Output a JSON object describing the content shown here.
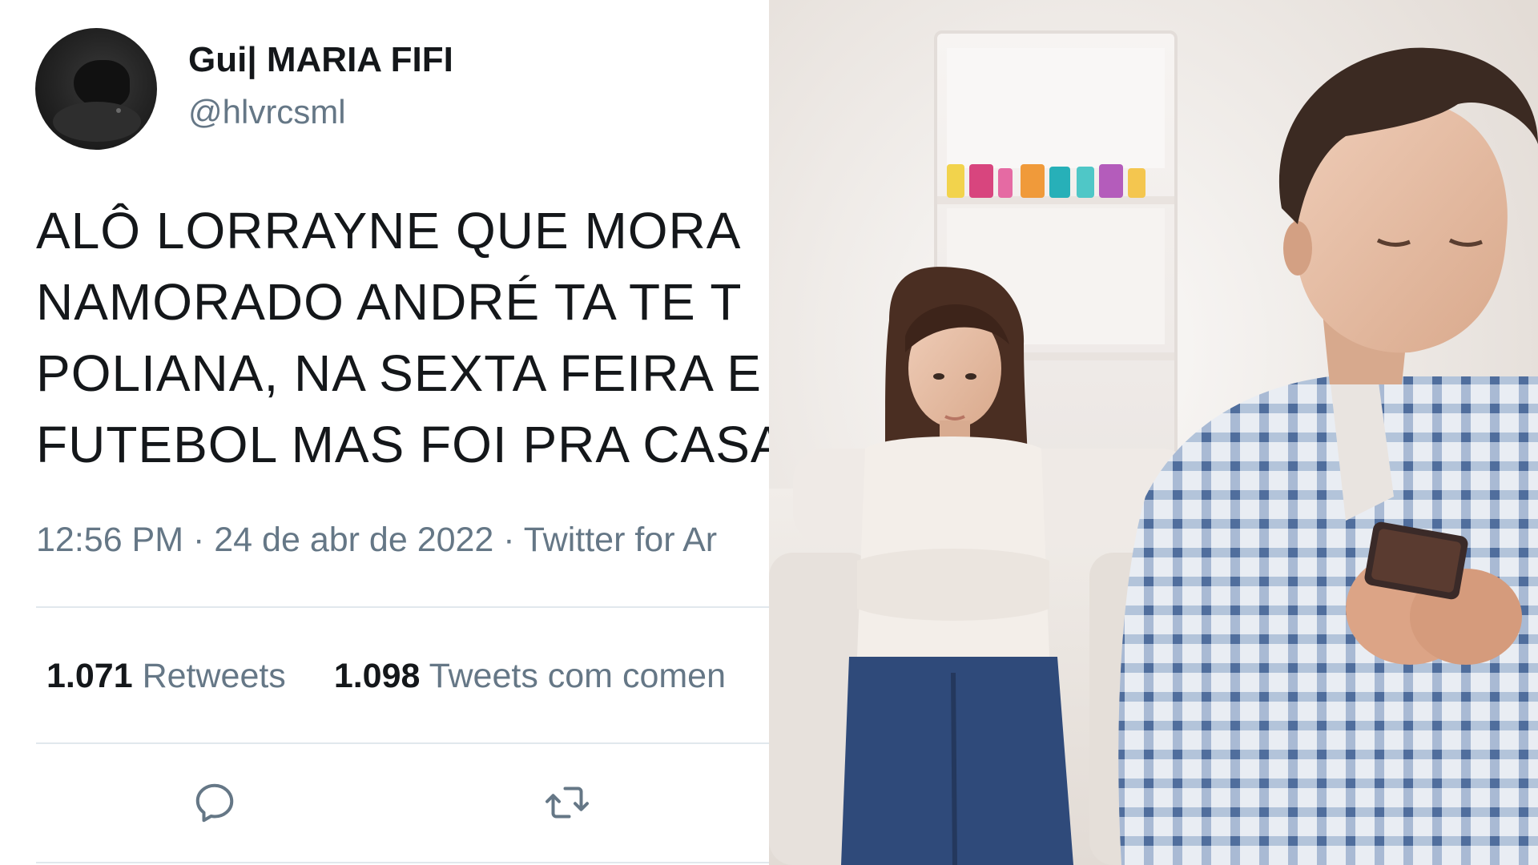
{
  "tweet": {
    "display_name": "Gui| MARIA FIFI",
    "handle": "@hlvrcsml",
    "text_lines": [
      "ALÔ LORRAYNE QUE MORA",
      "NAMORADO ANDRÉ TA TE T",
      "POLIANA, NA SEXTA FEIRA E",
      "FUTEBOL MAS FOI PRA CASA"
    ],
    "timestamp": "12:56 PM · 24 de abr de 2022 · Twitter for Ar",
    "retweets_count": "1.071",
    "retweets_label": "Retweets",
    "quotes_count": "1.098",
    "quotes_label": "Tweets com comen",
    "icons": [
      "avatar",
      "reply-icon",
      "retweet-icon"
    ]
  },
  "colors": {
    "text_primary": "#14171a",
    "text_secondary": "#657786",
    "divider": "#e1e8ed"
  }
}
